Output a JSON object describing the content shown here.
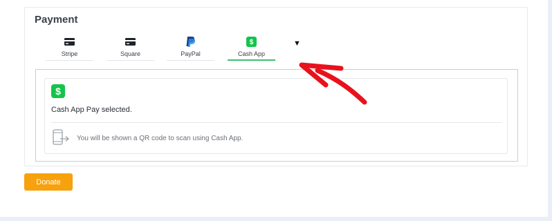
{
  "payment": {
    "heading": "Payment",
    "tabs": [
      {
        "label": "Stripe",
        "icon": "credit-card-icon"
      },
      {
        "label": "Square",
        "icon": "credit-card-icon"
      },
      {
        "label": "PayPal",
        "icon": "paypal-icon"
      },
      {
        "label": "Cash App",
        "icon": "cash-app-icon"
      }
    ],
    "active_tab": "Cash App",
    "accent_color": "#3bbf6e",
    "cash_app_color": "#14c44a",
    "selected_text": "Cash App Pay selected.",
    "qr_message": "You will be shown a QR code to scan using Cash App."
  },
  "donate_label": "Donate",
  "donate_color": "#f7a10c",
  "annotation_color": "#e8121c"
}
